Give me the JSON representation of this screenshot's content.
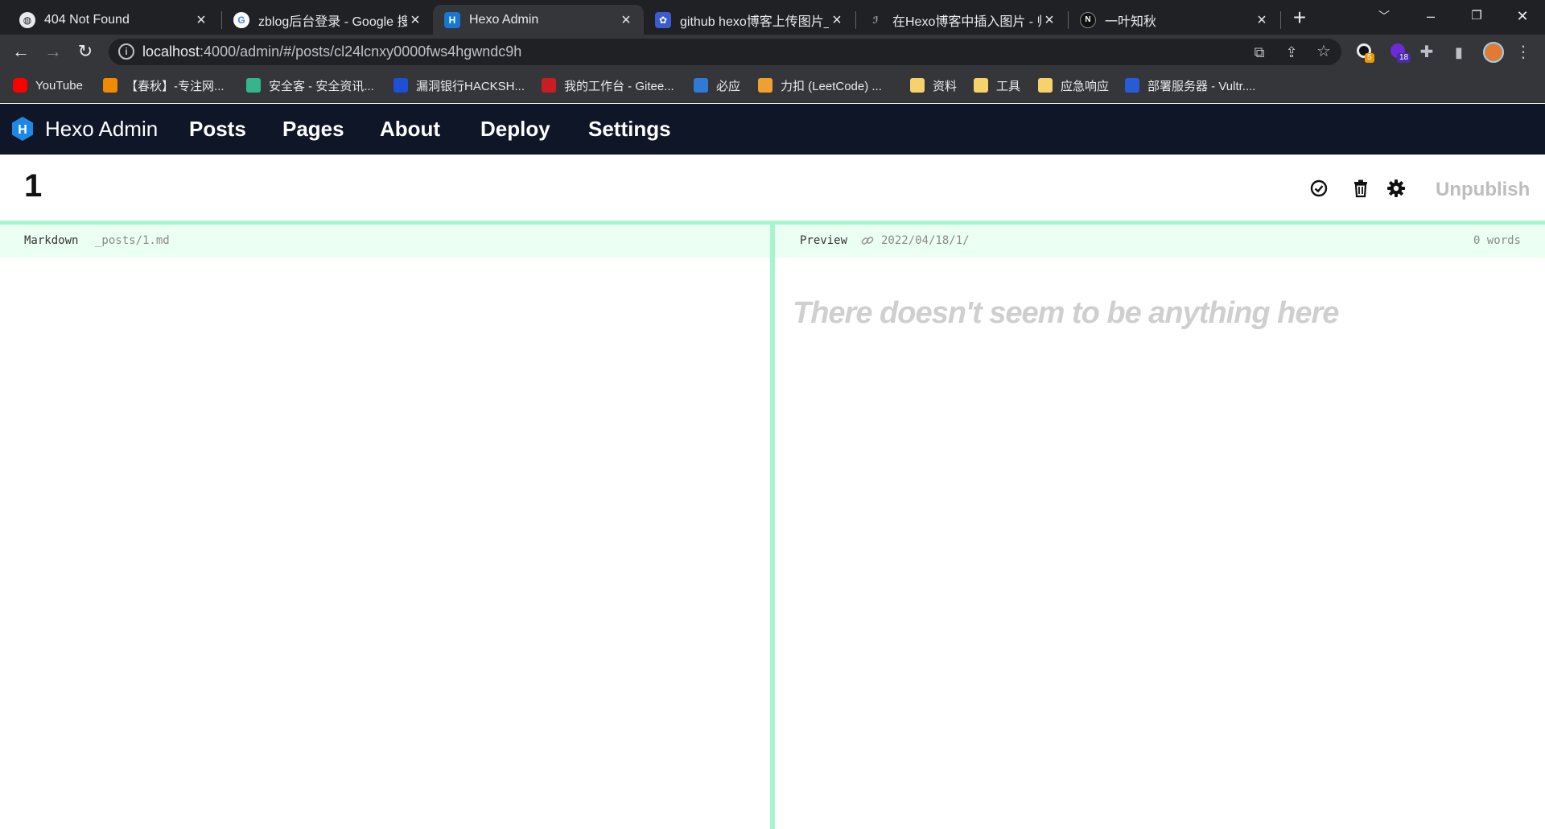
{
  "browser": {
    "tabs": [
      {
        "title": "404 Not Found",
        "icon": "globe-icon"
      },
      {
        "title": "zblog后台登录 - Google 搜",
        "icon": "google-icon"
      },
      {
        "title": "Hexo Admin",
        "icon": "hexo-icon",
        "active": true
      },
      {
        "title": "github hexo博客上传图片_",
        "icon": "baidu-icon"
      },
      {
        "title": "在Hexo博客中插入图片 - 帅",
        "icon": "site-icon"
      },
      {
        "title": "一叶知秋",
        "icon": "notion-icon"
      }
    ],
    "address": {
      "host": "localhost",
      "path": ":4000/admin/#/posts/cl24lcnxy0000fws4hgwndc9h"
    },
    "extension_badges": {
      "first": "5",
      "second": "18"
    },
    "bookmarks": [
      {
        "label": "YouTube",
        "color": "#ff0000"
      },
      {
        "label": "【春秋】-专注网...",
        "color": "#f08a00"
      },
      {
        "label": "安全客 - 安全资讯...",
        "color": "#35b58c"
      },
      {
        "label": "漏洞银行HACKSH...",
        "color": "#1f4fd6"
      },
      {
        "label": "我的工作台 - Gitee...",
        "color": "#c71d23"
      },
      {
        "label": "必应",
        "color": "#2e7ad4"
      },
      {
        "label": "力扣 (LeetCode) ...",
        "color": "#f0a030"
      },
      {
        "label": "资料",
        "color": "#f4d36b"
      },
      {
        "label": "工具",
        "color": "#f4d36b"
      },
      {
        "label": "应急响应",
        "color": "#f4d36b"
      },
      {
        "label": "部署服务器 - Vultr....",
        "color": "#2a5bd7"
      }
    ]
  },
  "app": {
    "brand": "Hexo Admin",
    "nav": [
      "Posts",
      "Pages",
      "About",
      "Deploy",
      "Settings"
    ]
  },
  "post": {
    "title": "1",
    "unpublish_label": "Unpublish"
  },
  "editor": {
    "label": "Markdown",
    "path": "_posts/1.md"
  },
  "preview": {
    "label": "Preview",
    "permalink": "2022/04/18/1/",
    "word_count": "0 words",
    "empty_message": "There doesn't seem to be anything here"
  },
  "colors": {
    "accent_green": "#a7f5cd",
    "nav_bg": "#0e1627",
    "pane_header_bg": "#ecfff3"
  }
}
